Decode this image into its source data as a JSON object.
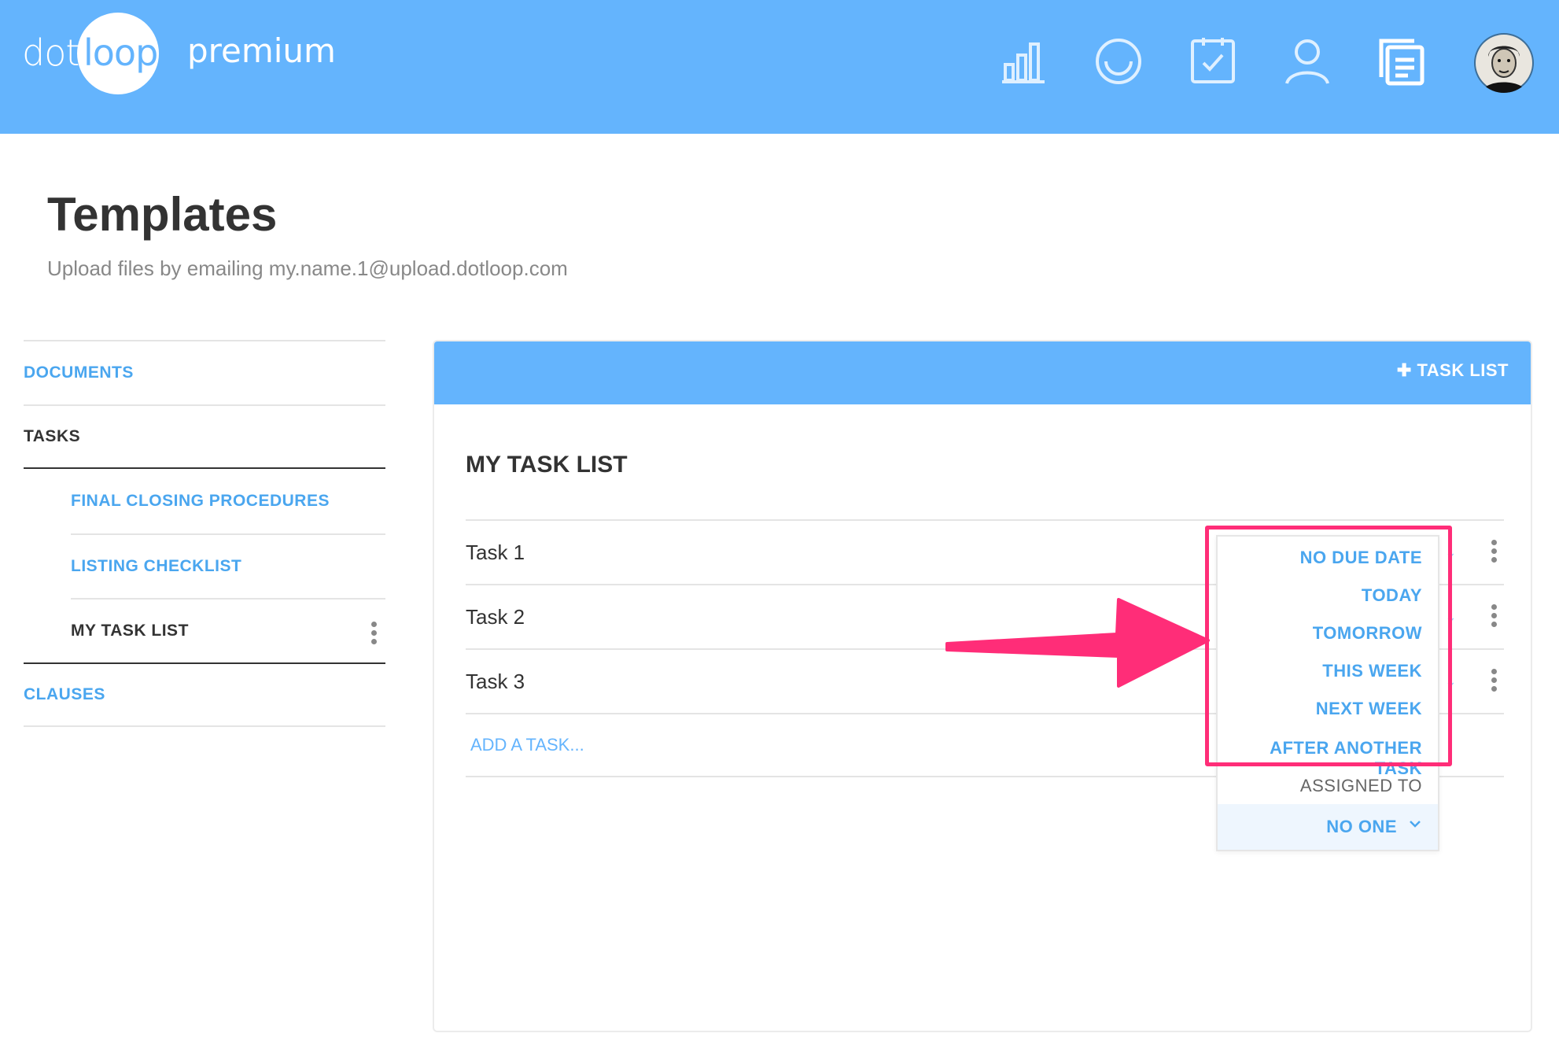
{
  "app": {
    "logo_dot": "dot",
    "logo_loop": "loop",
    "logo_edition": "premium",
    "brand_color": "#64b4fd",
    "accent_color": "#4aa6ef",
    "annotation_color": "#ff2d78"
  },
  "nav": {
    "icons": [
      "bar-chart-icon",
      "loop-circle-icon",
      "task-check-icon",
      "person-icon",
      "documents-icon"
    ],
    "avatar": "user-avatar"
  },
  "page": {
    "title": "Templates",
    "subtitle": "Upload files by emailing my.name.1@upload.dotloop.com"
  },
  "sidebar": {
    "documents": "DOCUMENTS",
    "tasks": "TASKS",
    "lists": [
      "FINAL CLOSING PROCEDURES",
      "LISTING CHECKLIST",
      "MY TASK LIST"
    ],
    "clauses": "CLAUSES"
  },
  "panel": {
    "add_task_list": "TASK LIST",
    "title": "MY TASK LIST",
    "tasks": [
      "Task 1",
      "Task 2",
      "Task 3"
    ],
    "add_task": "ADD A TASK..."
  },
  "dropdown": {
    "due_options": [
      "NO DUE DATE",
      "TODAY",
      "TOMORROW",
      "THIS WEEK",
      "NEXT WEEK",
      "AFTER ANOTHER TASK"
    ],
    "assigned_label": "ASSIGNED TO",
    "assigned_value": "NO ONE"
  }
}
